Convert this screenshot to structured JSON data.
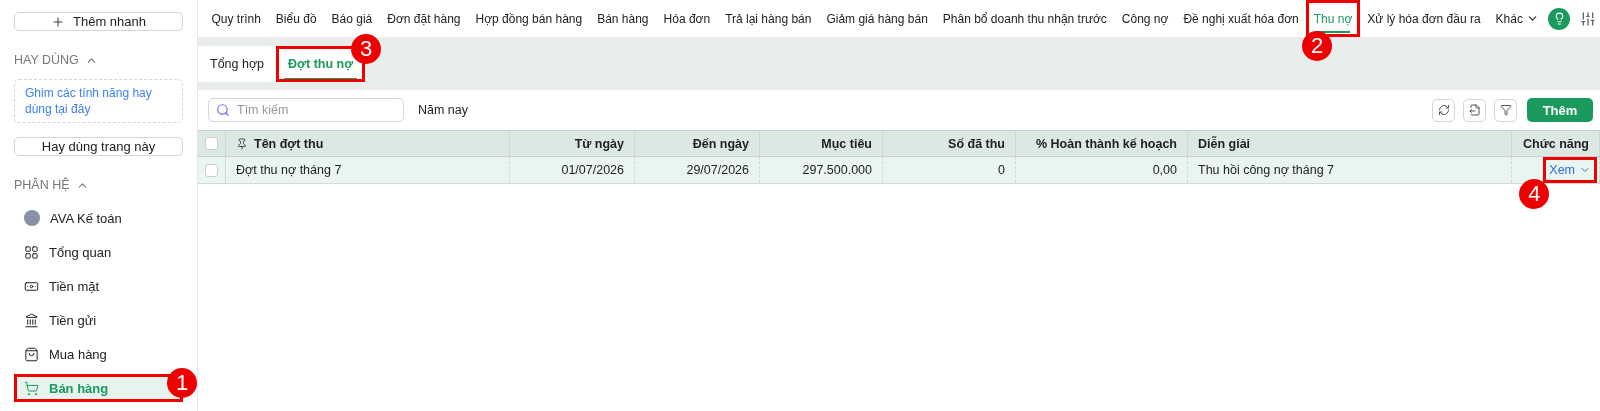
{
  "sidebar": {
    "quick_add": "Thêm nhanh",
    "favorites": {
      "title": "HAY DÙNG",
      "expanded": true,
      "pin_hint": "Ghim các tính năng hay dùng tại đây",
      "button": "Hay dùng trang này"
    },
    "modules": {
      "title": "PHÂN HỆ",
      "expanded": true,
      "items": [
        {
          "kind": "avatar",
          "label": "AVA Kế toán",
          "selected": false
        },
        {
          "kind": "grid",
          "label": "Tổng quan",
          "selected": false
        },
        {
          "kind": "cash",
          "label": "Tiền mặt",
          "selected": false
        },
        {
          "kind": "bank",
          "label": "Tiền gửi",
          "selected": false
        },
        {
          "kind": "bag",
          "label": "Mua hàng",
          "selected": false
        },
        {
          "kind": "cart",
          "label": "Bán hàng",
          "selected": true,
          "callout": "1"
        }
      ]
    }
  },
  "nav": {
    "items": [
      {
        "label": "Quy trình",
        "selected": false
      },
      {
        "label": "Biểu đồ",
        "selected": false
      },
      {
        "label": "Báo giá",
        "selected": false
      },
      {
        "label": "Đơn đặt hàng",
        "selected": false
      },
      {
        "label": "Hợp đồng bán hàng",
        "selected": false
      },
      {
        "label": "Bán hàng",
        "selected": false
      },
      {
        "label": "Hóa đơn",
        "selected": false
      },
      {
        "label": "Trả lại hàng bán",
        "selected": false
      },
      {
        "label": "Giảm giá hàng bán",
        "selected": false
      },
      {
        "label": "Phân bổ doanh thu nhận trước",
        "selected": false
      },
      {
        "label": "Công nợ",
        "selected": false
      },
      {
        "label": "Đề nghị xuất hóa đơn",
        "selected": false
      },
      {
        "label": "Thu nợ",
        "selected": true,
        "callout": "2"
      },
      {
        "label": "Xử lý hóa đơn đầu ra",
        "selected": false
      }
    ],
    "more": "Khác"
  },
  "subtabs": [
    {
      "label": "Tổng hợp",
      "selected": false
    },
    {
      "label": "Đợt thu nợ",
      "selected": true,
      "callout": "3"
    }
  ],
  "toolbar": {
    "search": {
      "placeholder": "Tìm kiếm"
    },
    "period": "Năm nay",
    "add_button": "Thêm"
  },
  "table": {
    "all_checked": false,
    "columns": [
      {
        "label": "Tên đợt thu"
      },
      {
        "label": "Từ ngày"
      },
      {
        "label": "Đến ngày"
      },
      {
        "label": "Mục tiêu"
      },
      {
        "label": "Số đã thu"
      },
      {
        "label": "% Hoàn thành kế hoạch"
      },
      {
        "label": "Diễn giải"
      },
      {
        "label": "Chức năng"
      }
    ],
    "rows": [
      {
        "checked": false,
        "cells": [
          "Đợt thu nợ tháng 7",
          "01/07/2026",
          "29/07/2026",
          "297.500.000",
          "0",
          "0,00",
          "Thu hồi công nợ tháng 7"
        ],
        "action": "Xem",
        "action_callout": "4"
      }
    ]
  }
}
